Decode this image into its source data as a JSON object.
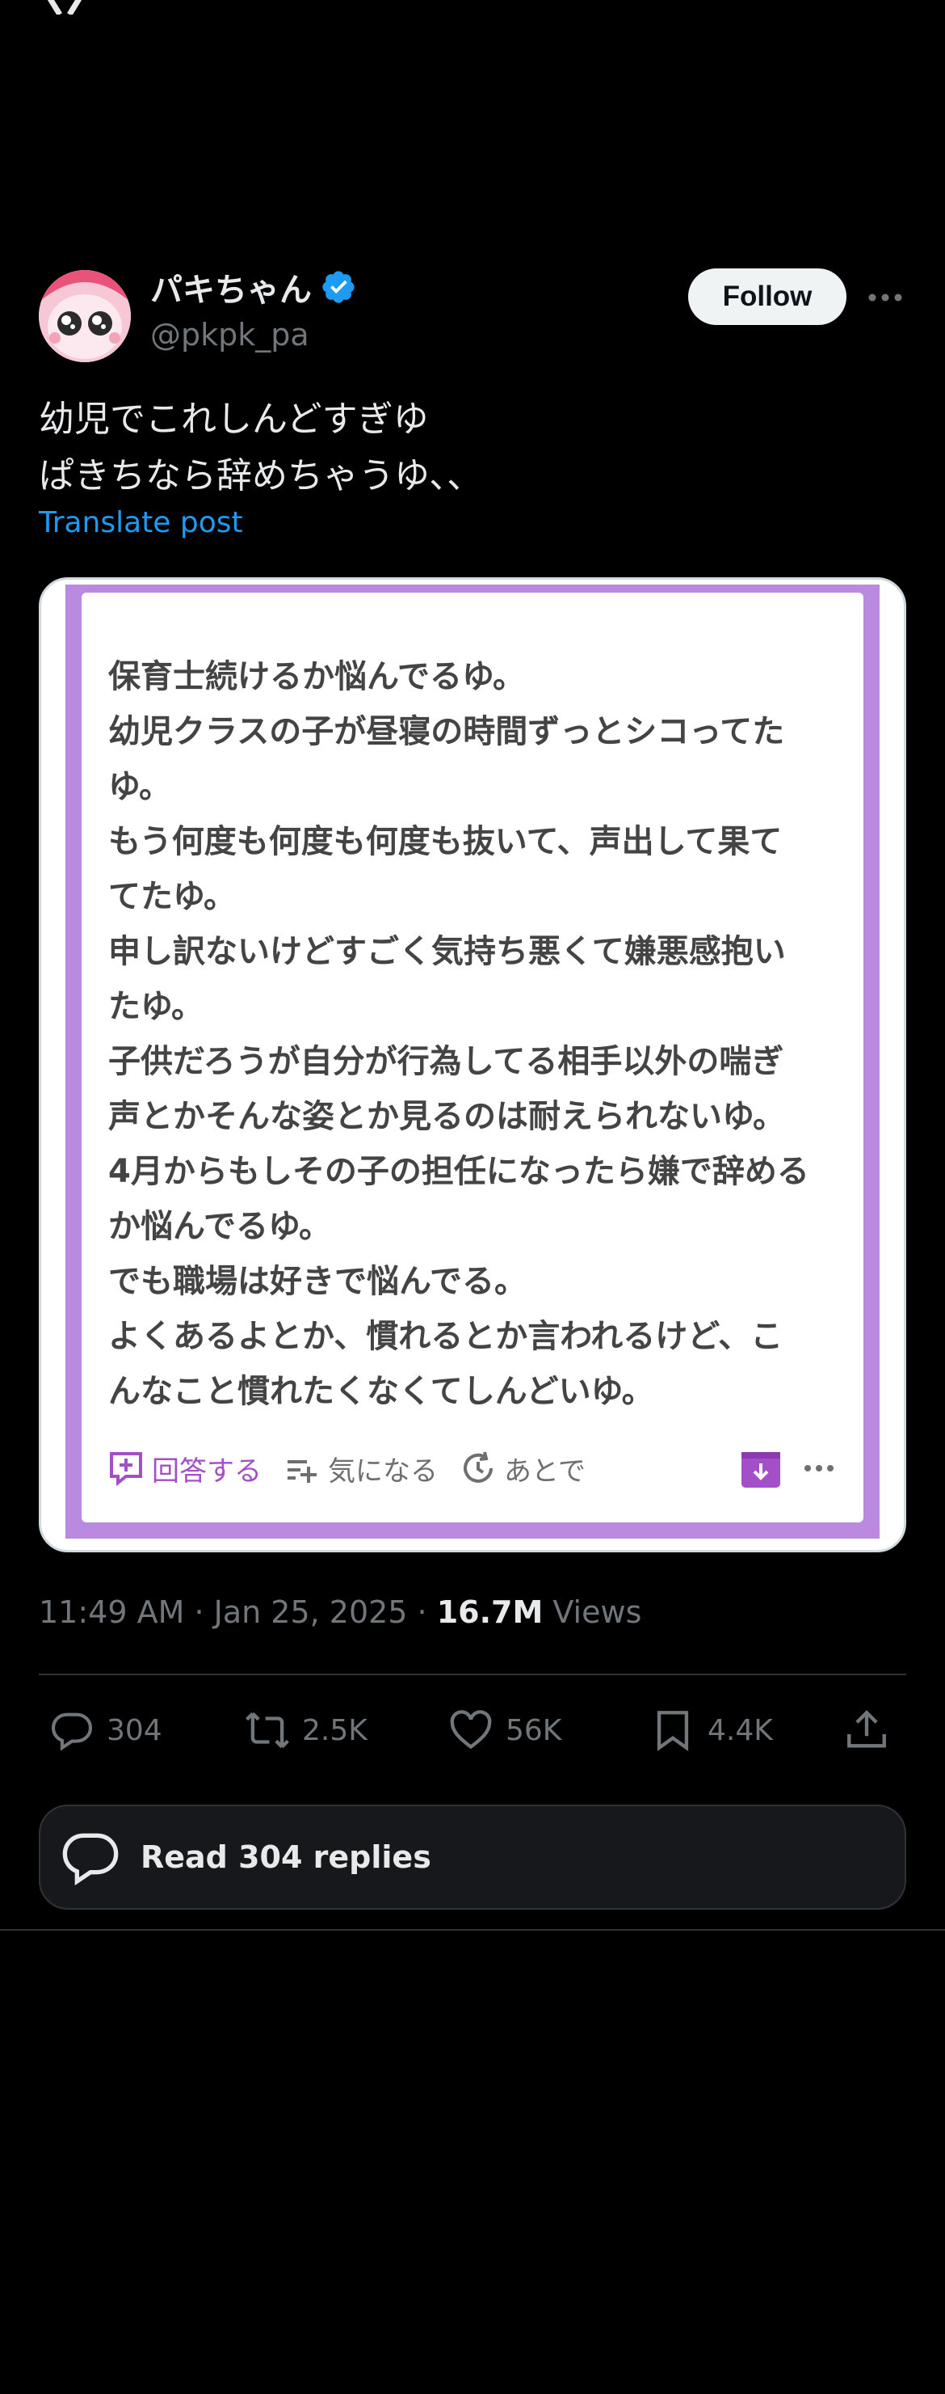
{
  "header": {
    "logo_icon": "x-logo-icon"
  },
  "author": {
    "display_name": "パキちゃん",
    "handle": "@pkpk_pa",
    "verified": true
  },
  "follow_label": "Follow",
  "tweet": {
    "line1": "幼児でこれしんどすぎゆ",
    "line2": "ぱきちなら辞めちゃうゆ、、",
    "translate_label": "Translate post"
  },
  "card": {
    "lines": [
      "保育士続けるか悩んでるゆ。",
      "幼児クラスの子が昼寝の時間ずっとシコってた",
      "ゆ。",
      "もう何度も何度も何度も抜いて、声出して果て",
      "てたゆ。",
      "申し訳ないけどすごく気持ち悪くて嫌悪感抱い",
      "たゆ。",
      "子供だろうが自分が行為してる相手以外の喘ぎ",
      "声とかそんな姿とか見るのは耐えられないゆ。",
      "4月からもしその子の担任になったら嫌で辞める",
      "か悩んでるゆ。",
      "でも職場は好きで悩んでる。",
      "よくあるよとか、慣れるとか言われるけど、こ",
      "んなこと慣れたくなくてしんどいゆ。"
    ],
    "answer_label": "回答する",
    "interest_label": "気になる",
    "later_label": "あとで",
    "accent_color": "#b98ae0"
  },
  "meta": {
    "time": "11:49 AM · Jan 25, 2025 · ",
    "views_count": "16.7M",
    "views_label": " Views"
  },
  "stats": {
    "replies": "304",
    "reposts": "2.5K",
    "likes": "56K",
    "bookmarks": "4.4K"
  },
  "read_replies_label": "Read 304 replies",
  "colors": {
    "link": "#1d9bf0",
    "verified": "#1d9bf0",
    "muted": "#71767b"
  }
}
